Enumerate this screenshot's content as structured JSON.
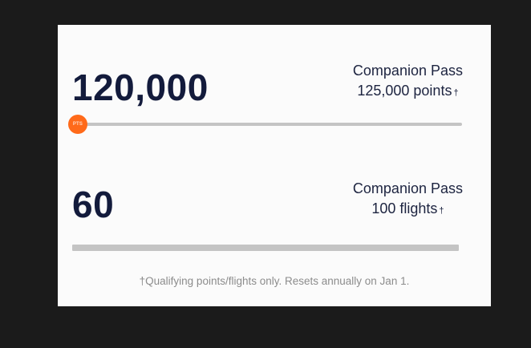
{
  "points": {
    "current": "120,000",
    "goal_title": "Companion Pass",
    "goal_value": "125,000 points",
    "dagger": "†",
    "marker_label": "PTS",
    "progress_fraction": 0.0
  },
  "flights": {
    "current": "60",
    "goal_title": "Companion Pass",
    "goal_value": "100 flights",
    "dagger": "†",
    "progress_fraction": 0.0
  },
  "footnote": "†Qualifying points/flights only. Resets annually on Jan 1.",
  "colors": {
    "background": "#1b1b1b",
    "card": "#fbfbfb",
    "number": "#131b3c",
    "marker": "#ff6a1a",
    "track": "#c4c4c4"
  }
}
